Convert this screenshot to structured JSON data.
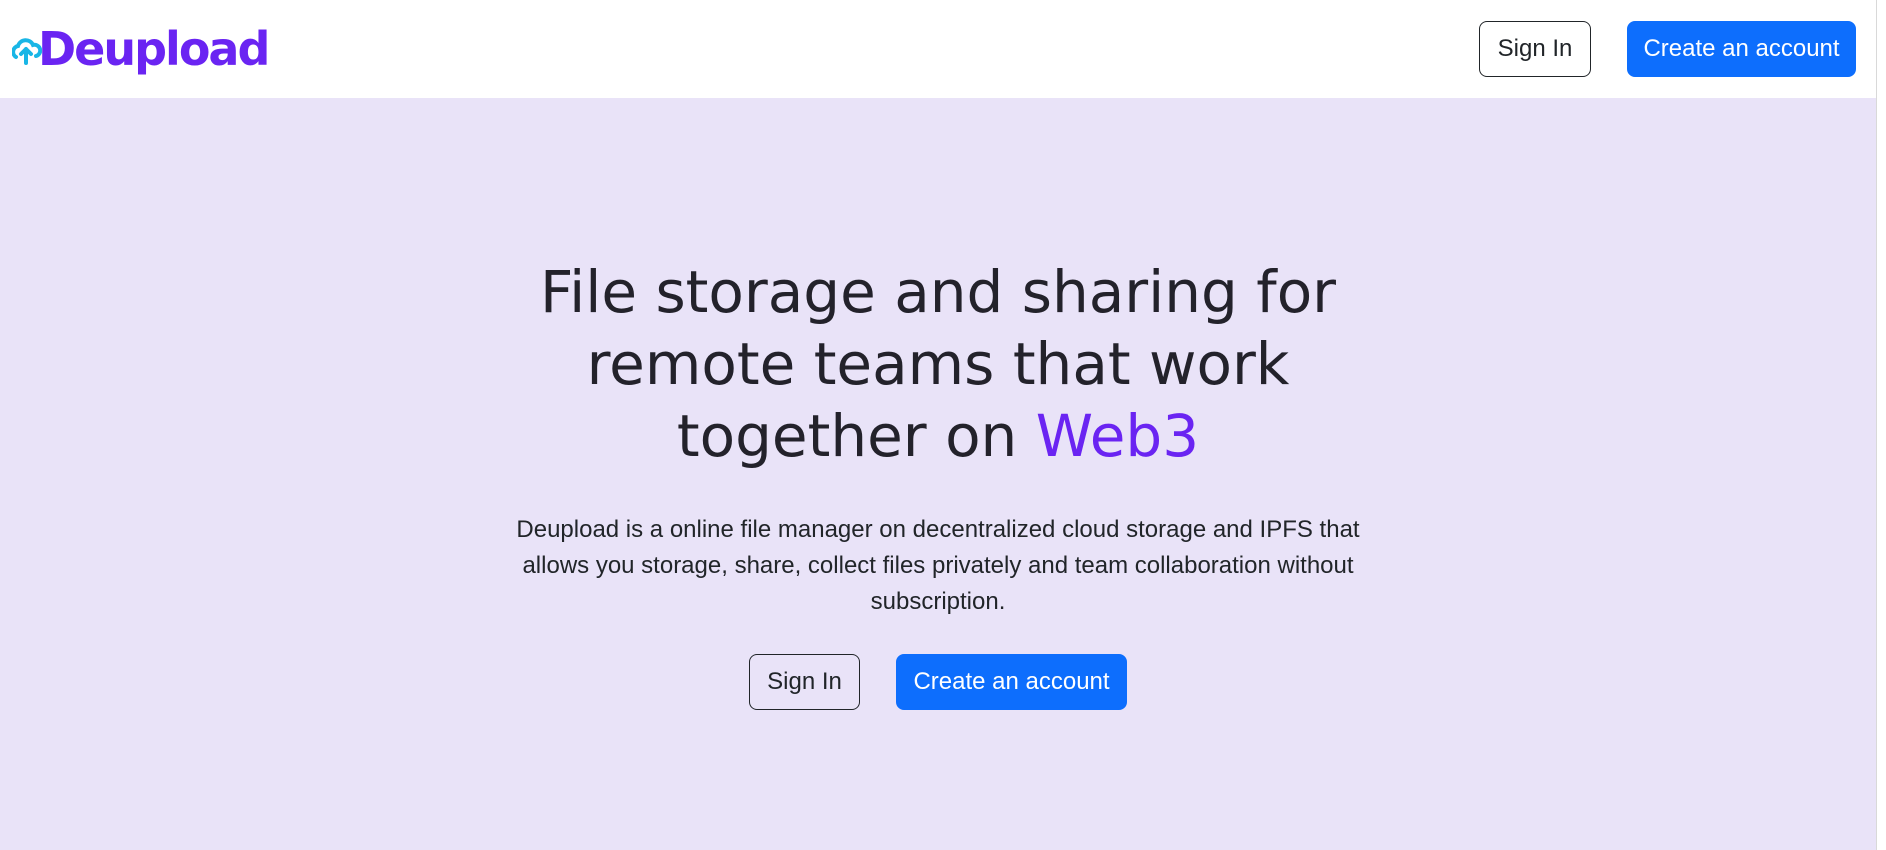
{
  "brand": {
    "name": "Deupload",
    "accent_color": "#6a24f2",
    "logo_icon": "cloud-upload-icon"
  },
  "nav": {
    "sign_in_label": "Sign In",
    "create_account_label": "Create an account"
  },
  "hero": {
    "title_main": "File storage and sharing for remote teams that work together on",
    "title_highlight": "Web3",
    "description": "Deupload is a online file manager on decentralized cloud storage and IPFS that allows you storage, share, collect files privately and team collaboration without subscription.",
    "sign_in_label": "Sign In",
    "create_account_label": "Create an account"
  },
  "colors": {
    "primary": "#0d6efd",
    "hero_background": "#e9e3f8",
    "text": "#23222b"
  }
}
